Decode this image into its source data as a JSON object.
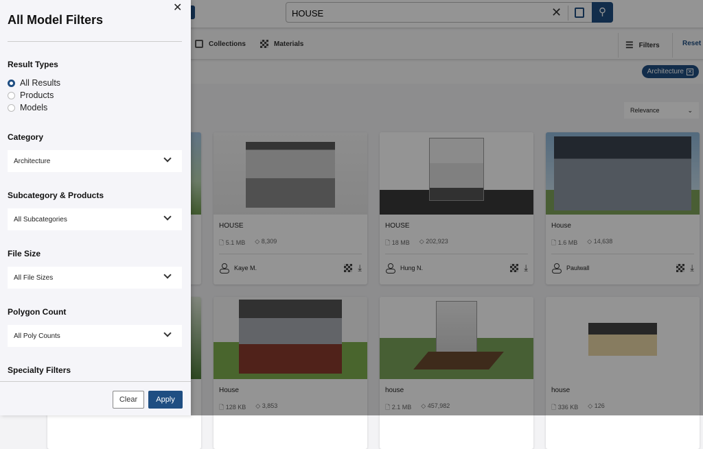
{
  "search": {
    "value": "HOUSE"
  },
  "nav": {
    "collections": "Collections",
    "materials": "Materials",
    "filters": "Filters",
    "reset": "Reset"
  },
  "chip": {
    "label": "Architecture"
  },
  "sort": {
    "value": "Relevance"
  },
  "cards": [
    {
      "title": "HOUSE",
      "size": "5.1 MB",
      "polys": "8,309",
      "author": "Kaye M."
    },
    {
      "title": "HOUSE",
      "size": "18 MB",
      "polys": "202,923",
      "author": "Hung N."
    },
    {
      "title": "House",
      "size": "1.6 MB",
      "polys": "14,638",
      "author": "Paulwall"
    },
    {
      "title": "House",
      "size": "128 KB",
      "polys": "3,853"
    },
    {
      "title": "house",
      "size": "2.1 MB",
      "polys": "457,982"
    },
    {
      "title": "house",
      "size": "336 KB",
      "polys": "126"
    }
  ],
  "panel": {
    "title": "All Model Filters",
    "result_types": {
      "label": "Result Types",
      "options": [
        "All Results",
        "Products",
        "Models"
      ],
      "selected": "All Results"
    },
    "category": {
      "label": "Category",
      "value": "Architecture"
    },
    "subcategory": {
      "label": "Subcategory & Products",
      "value": "All Subcategories"
    },
    "file_size": {
      "label": "File Size",
      "value": "All File Sizes"
    },
    "polygon": {
      "label": "Polygon Count",
      "value": "All Poly Counts"
    },
    "specialty": {
      "label": "Specialty Filters"
    },
    "clear": "Clear",
    "apply": "Apply"
  },
  "colors": {
    "accent": "#1f4e82"
  }
}
